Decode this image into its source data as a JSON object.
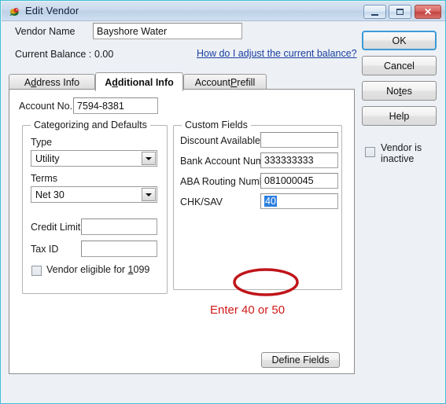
{
  "window": {
    "title": "Edit Vendor",
    "icon": "vendor-bird-icon",
    "controls": {
      "minimize": "minimize-icon",
      "maximize": "maximize-icon",
      "close": "✕"
    }
  },
  "header": {
    "vendor_name_label": "Vendor Name",
    "vendor_name_value": "Bayshore Water",
    "current_balance_label": "Current Balance :",
    "current_balance_value": "0.00",
    "adjust_link": "How do I adjust the current balance?"
  },
  "tabs": [
    {
      "label_pre": "A",
      "label_accel": "d",
      "label_post": "dress Info",
      "label": "Address Info",
      "active": false
    },
    {
      "label_pre": "A",
      "label_accel": "d",
      "label_post": "ditional Info",
      "label": "Additional Info",
      "active": true
    },
    {
      "label_pre": "Account ",
      "label_accel": "P",
      "label_post": "refill",
      "label": "Account Prefill",
      "active": false
    }
  ],
  "panel": {
    "account_no_label": "Account No.",
    "account_no_value": "7594-8381",
    "categorizing": {
      "title": "Categorizing and Defaults",
      "type_label": "Type",
      "type_value": "Utility",
      "terms_label": "Terms",
      "terms_value": "Net 30",
      "credit_limit_label": "Credit Limit",
      "credit_limit_value": "",
      "tax_id_label": "Tax ID",
      "tax_id_value": "",
      "eligible_1099_pre": "Vendor eligible for ",
      "eligible_1099_accel": "1",
      "eligible_1099_post": "099",
      "eligible_1099_label": "Vendor eligible for 1099",
      "eligible_1099_checked": false
    },
    "custom_fields": {
      "title": "Custom Fields",
      "rows": [
        {
          "label": "Discount Available",
          "value": ""
        },
        {
          "label": "Bank Account Number",
          "value": "333333333"
        },
        {
          "label": "ABA Routing Number",
          "value": "081000045"
        },
        {
          "label": "CHK/SAV",
          "value": "40",
          "selected": true
        }
      ],
      "define_fields_button": "Define Fields"
    },
    "annotation": {
      "note_text": "Enter 40 or 50",
      "note_color": "#d21919",
      "ellipse_color": "#c0151a",
      "ellipse_shape": "red-oval-highlight"
    }
  },
  "sidebar": {
    "ok_label": "OK",
    "cancel_label": "Cancel",
    "notes_pre": "No",
    "notes_accel": "t",
    "notes_post": "es",
    "notes_label": "Notes",
    "help_label": "Help",
    "inactive_label": "Vendor is inactive",
    "inactive_checked": false
  },
  "colors": {
    "dialog_bg": "#edf0f5",
    "window_border": "#3fbfd8",
    "titlebar": "#c9d9ec",
    "link": "#1a3fa0",
    "focus_border": "#3c9ad6",
    "selection_bg": "#2a7fe0"
  }
}
